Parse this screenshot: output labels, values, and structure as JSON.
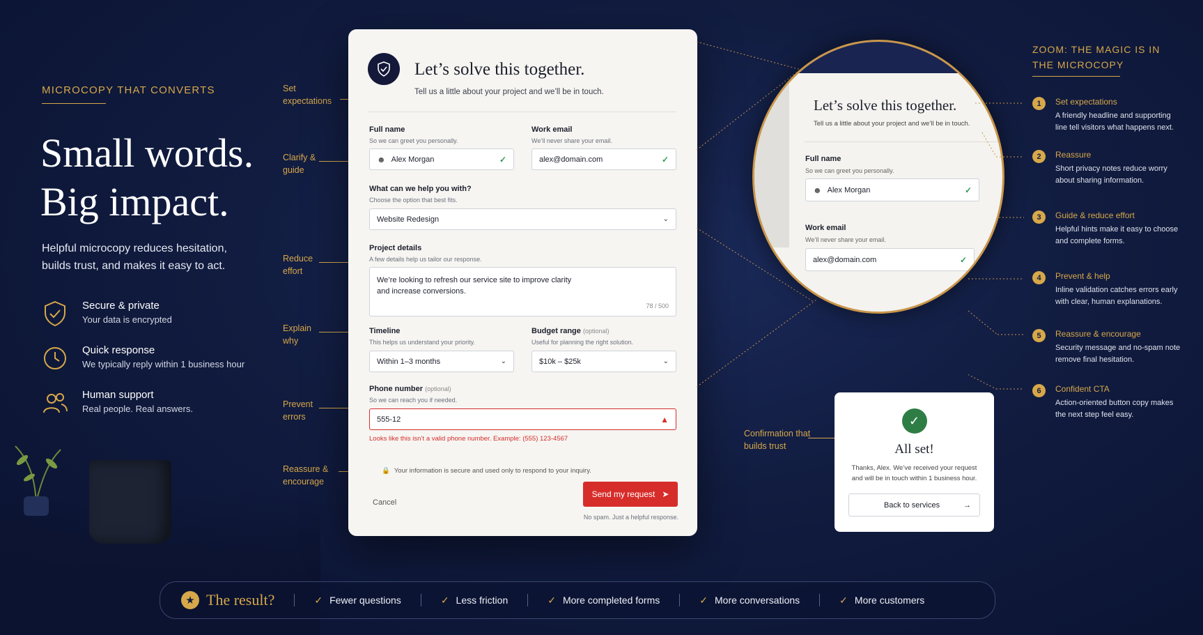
{
  "left": {
    "eyebrow": "MICROCOPY THAT CONVERTS",
    "headline_1": "Small words.",
    "headline_2": "Big impact.",
    "subtext": "Helpful microcopy reduces hesitation, builds trust, and makes it easy to act.",
    "features": [
      {
        "title": "Secure & private",
        "desc": "Your data is encrypted",
        "icon": "shield-check-icon"
      },
      {
        "title": "Quick response",
        "desc": "We typically reply within 1 business hour",
        "icon": "clock-icon"
      },
      {
        "title": "Human support",
        "desc": "Real people. Real answers.",
        "icon": "people-icon"
      }
    ]
  },
  "annotations": {
    "set_expectations": "Set expectations",
    "clarify_guide": "Clarify & guide",
    "reduce_effort": "Reduce effort",
    "explain_why": "Explain why",
    "prevent_errors": "Prevent errors",
    "reassure_encourage": "Reassure & encourage",
    "confirmation": "Confirmation that builds trust"
  },
  "form": {
    "title": "Let’s solve this together.",
    "subtitle": "Tell us a little about your project and we’ll be in touch.",
    "full_name": {
      "label": "Full name",
      "hint": "So we can greet you personally.",
      "value": "Alex Morgan"
    },
    "work_email": {
      "label": "Work email",
      "hint": "We’ll never share your email.",
      "value": "alex@domain.com"
    },
    "help": {
      "label": "What can we help you with?",
      "hint": "Choose the option that best fits.",
      "value": "Website Redesign"
    },
    "details": {
      "label": "Project details",
      "hint": "A few details help us tailor our response.",
      "value_1": "We’re looking to refresh our service site to improve clarity",
      "value_2": "and increase conversions.",
      "counter": "78 / 500"
    },
    "timeline": {
      "label": "Timeline",
      "hint": "This helps us understand your priority.",
      "value": "Within 1–3 months"
    },
    "budget": {
      "label": "Budget range",
      "optional": "(optional)",
      "hint": "Useful for planning the right solution.",
      "value": "$10k – $25k"
    },
    "phone": {
      "label": "Phone number",
      "optional": "(optional)",
      "hint": "So we can reach you if needed.",
      "value": "555-12",
      "error": "Looks like this isn’t a valid phone number. Example: (555) 123-4567"
    },
    "secure_note": "Your information is secure and used only to respond to your inquiry.",
    "cancel": "Cancel",
    "submit": "Send my request",
    "no_spam": "No spam. Just a helpful response."
  },
  "zoom": {
    "heading_1": "ZOOM: THE MAGIC IS IN",
    "heading_2": "THE MICROCOPY",
    "title": "Let’s solve this together.",
    "subtitle": "Tell us a little about your project and we’ll be in touch.",
    "name_label": "Full name",
    "name_hint": "So we can greet you personally.",
    "name_value": "Alex Morgan",
    "email_label": "Work email",
    "email_hint": "We’ll never share your email.",
    "email_value": "alex@domain.com"
  },
  "points": [
    {
      "n": "1",
      "title": "Set expectations",
      "desc": "A friendly headline and supporting line tell visitors what happens next."
    },
    {
      "n": "2",
      "title": "Reassure",
      "desc": "Short privacy notes reduce worry about sharing information."
    },
    {
      "n": "3",
      "title": "Guide & reduce effort",
      "desc": "Helpful hints make it easy to choose and complete forms."
    },
    {
      "n": "4",
      "title": "Prevent & help",
      "desc": "Inline validation catches errors early with clear, human explanations."
    },
    {
      "n": "5",
      "title": "Reassure & encourage",
      "desc": "Security message and no-spam note remove final hesitation."
    },
    {
      "n": "6",
      "title": "Confident CTA",
      "desc": "Action-oriented button copy makes the next step feel easy."
    }
  ],
  "success": {
    "title": "All set!",
    "message_1": "Thanks, Alex. We’ve received your request",
    "message_2": "and will be in touch within 1 business hour.",
    "button": "Back to services"
  },
  "result_bar": {
    "title": "The result?",
    "items": [
      "Fewer questions",
      "Less friction",
      "More completed forms",
      "More conversations",
      "More customers"
    ]
  },
  "colors": {
    "accent": "#d7a84a",
    "cta": "#d72d2a",
    "background": "#111c40",
    "success": "#2e9a55"
  }
}
